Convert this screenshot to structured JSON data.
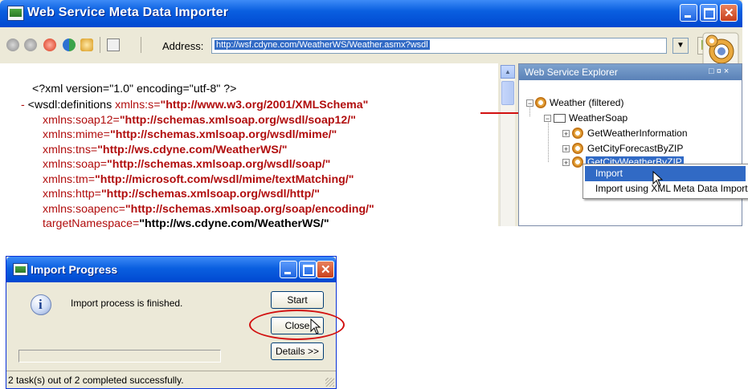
{
  "main_window": {
    "title": "Web Service Meta Data Importer",
    "address_label": "Address:",
    "address_url": "http://wsf.cdyne.com/WeatherWS/Weather.asmx?wsdl",
    "xml_lines": [
      {
        "prefix": "",
        "parts": [
          {
            "t": "<?xml version=\"1.0\" encoding=\"utf-8\" ?>",
            "c": "blk"
          }
        ]
      },
      {
        "prefix": "- ",
        "parts": [
          {
            "t": "<wsdl:definitions ",
            "c": "blk"
          },
          {
            "t": "xmlns:s=",
            "c": "attr"
          },
          {
            "t": "\"http://www.w3.org/2001/XMLSchema\"",
            "c": "aval"
          }
        ]
      },
      {
        "prefix": "",
        "parts": [
          {
            "t": "xmlns:soap12=",
            "c": "attr"
          },
          {
            "t": "\"http://schemas.xmlsoap.org/wsdl/soap12/\"",
            "c": "aval"
          }
        ]
      },
      {
        "prefix": "",
        "parts": [
          {
            "t": "xmlns:mime=",
            "c": "attr"
          },
          {
            "t": "\"http://schemas.xmlsoap.org/wsdl/mime/\"",
            "c": "aval"
          }
        ]
      },
      {
        "prefix": "",
        "parts": [
          {
            "t": "xmlns:tns=",
            "c": "attr"
          },
          {
            "t": "\"http://ws.cdyne.com/WeatherWS/\"",
            "c": "aval"
          }
        ]
      },
      {
        "prefix": "",
        "parts": [
          {
            "t": "xmlns:soap=",
            "c": "attr"
          },
          {
            "t": "\"http://schemas.xmlsoap.org/wsdl/soap/\"",
            "c": "aval"
          }
        ]
      },
      {
        "prefix": "",
        "parts": [
          {
            "t": "xmlns:tm=",
            "c": "attr"
          },
          {
            "t": "\"http://microsoft.com/wsdl/mime/textMatching/\"",
            "c": "aval"
          }
        ]
      },
      {
        "prefix": "",
        "parts": [
          {
            "t": "xmlns:http=",
            "c": "attr"
          },
          {
            "t": "\"http://schemas.xmlsoap.org/wsdl/http/\"",
            "c": "aval"
          }
        ]
      },
      {
        "prefix": "",
        "parts": [
          {
            "t": "xmlns:soapenc=",
            "c": "attr"
          },
          {
            "t": "\"http://schemas.xmlsoap.org/soap/encoding/\"",
            "c": "aval"
          }
        ]
      },
      {
        "prefix": "",
        "parts": [
          {
            "t": "targetNamespace=",
            "c": "attr"
          },
          {
            "t": "\"http://ws.cdyne.com/WeatherWS/\"",
            "c": "blkb"
          }
        ]
      }
    ]
  },
  "explorer": {
    "title": "Web Service Explorer",
    "controls": "□ ¤ ×",
    "tree": {
      "root": "Weather (filtered)",
      "port": "WeatherSoap",
      "operations": [
        "GetWeatherInformation",
        "GetCityForecastByZIP",
        "GetCityWeatherByZIP"
      ]
    },
    "context_menu": [
      "Import",
      "Import using XML Meta Data Import"
    ]
  },
  "dialog": {
    "title": "Import Progress",
    "message": "Import process is finished.",
    "buttons": {
      "start": "Start",
      "close": "Close",
      "details": "Details >>"
    },
    "status": "2 task(s) out of 2 completed successfully.",
    "progress_fraction": 0
  },
  "colors": {
    "title_blue": "#0a5fe0",
    "xml_red": "#b10d0d",
    "highlight": "#316ac5",
    "annotation_red": "#d21010"
  }
}
